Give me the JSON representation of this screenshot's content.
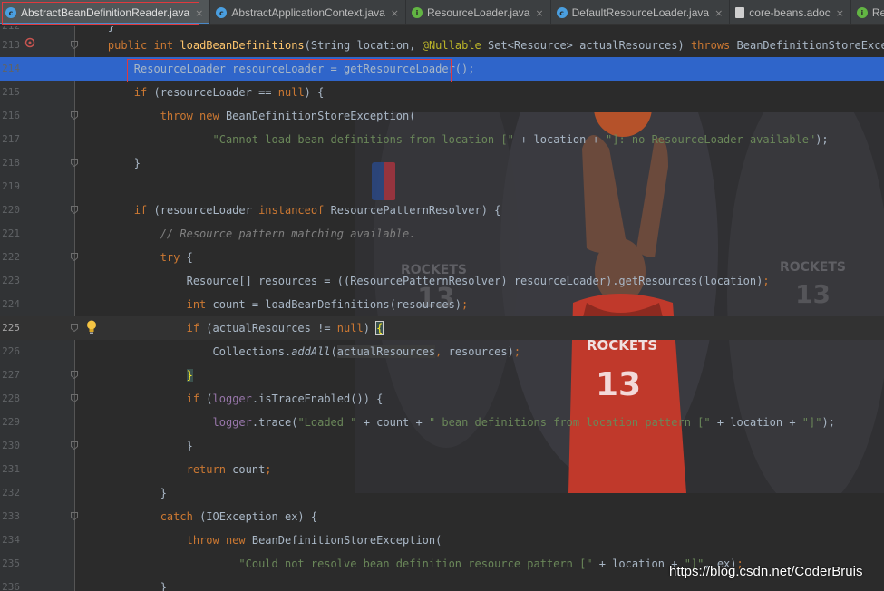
{
  "tabs": [
    {
      "label": "AbstractBeanDefinitionReader.java",
      "icon": "class-icon",
      "color": "#4a9fe0",
      "active": true,
      "closable": true
    },
    {
      "label": "AbstractApplicationContext.java",
      "icon": "class-icon",
      "color": "#4a9fe0",
      "active": false,
      "closable": true
    },
    {
      "label": "ResourceLoader.java",
      "icon": "interface-icon",
      "color": "#62b543",
      "active": false,
      "closable": true
    },
    {
      "label": "DefaultResourceLoader.java",
      "icon": "class-icon",
      "color": "#4a9fe0",
      "active": false,
      "closable": true
    },
    {
      "label": "core-beans.adoc",
      "icon": "file-icon",
      "color": "#cfcfcf",
      "active": false,
      "closable": true
    },
    {
      "label": "ResourcePatte",
      "icon": "interface-icon",
      "color": "#62b543",
      "active": false,
      "closable": false
    }
  ],
  "tab_glyphs": {
    "class": "c",
    "interface": "i",
    "close": "×"
  },
  "editor": {
    "current_line": "225",
    "selected_line": "214",
    "background_jersey": {
      "team": "ROCKETS",
      "number": "13"
    },
    "lines": [
      {
        "num": "212",
        "tokens": [
          {
            "t": "    }",
            "c": ""
          }
        ]
      },
      {
        "num": "213",
        "tokens": [
          {
            "t": "    ",
            "c": ""
          },
          {
            "t": "public int ",
            "c": "kw"
          },
          {
            "t": "loadBeanDefinitions",
            "c": "fn"
          },
          {
            "t": "(String location, ",
            "c": ""
          },
          {
            "t": "@Nullable",
            "c": "ann"
          },
          {
            "t": " Set<Resource> actualResources) ",
            "c": ""
          },
          {
            "t": "throws ",
            "c": "kw"
          },
          {
            "t": "BeanDefinitionStoreException {",
            "c": ""
          }
        ]
      },
      {
        "num": "214",
        "tokens": [
          {
            "t": "        ResourceLoader resourceLoader = getResourceLoader();",
            "c": ""
          }
        ]
      },
      {
        "num": "215",
        "tokens": [
          {
            "t": "        ",
            "c": ""
          },
          {
            "t": "if ",
            "c": "kw"
          },
          {
            "t": "(resourceLoader == ",
            "c": ""
          },
          {
            "t": "null",
            "c": "kw"
          },
          {
            "t": ") {",
            "c": ""
          }
        ]
      },
      {
        "num": "216",
        "tokens": [
          {
            "t": "            ",
            "c": ""
          },
          {
            "t": "throw new ",
            "c": "kw"
          },
          {
            "t": "BeanDefinitionStoreException(",
            "c": ""
          }
        ]
      },
      {
        "num": "217",
        "tokens": [
          {
            "t": "                    ",
            "c": ""
          },
          {
            "t": "\"Cannot load bean definitions from location [\"",
            "c": "str"
          },
          {
            "t": " + location + ",
            "c": ""
          },
          {
            "t": "\"]: no ResourceLoader available\"",
            "c": "str"
          },
          {
            "t": ");",
            "c": ""
          }
        ]
      },
      {
        "num": "218",
        "tokens": [
          {
            "t": "        }",
            "c": ""
          }
        ]
      },
      {
        "num": "219",
        "tokens": []
      },
      {
        "num": "220",
        "tokens": [
          {
            "t": "        ",
            "c": ""
          },
          {
            "t": "if ",
            "c": "kw"
          },
          {
            "t": "(resourceLoader ",
            "c": ""
          },
          {
            "t": "instanceof ",
            "c": "kw"
          },
          {
            "t": "ResourcePatternResolver) {",
            "c": ""
          }
        ]
      },
      {
        "num": "221",
        "tokens": [
          {
            "t": "            ",
            "c": ""
          },
          {
            "t": "// Resource pattern matching available.",
            "c": "cmt"
          }
        ]
      },
      {
        "num": "222",
        "tokens": [
          {
            "t": "            ",
            "c": ""
          },
          {
            "t": "try ",
            "c": "kw"
          },
          {
            "t": "{",
            "c": ""
          }
        ]
      },
      {
        "num": "223",
        "tokens": [
          {
            "t": "                Resource[] resources = ((ResourcePatternResolver) resourceLoader).getResources(location)",
            "c": ""
          },
          {
            "t": ";",
            "c": "kw"
          }
        ]
      },
      {
        "num": "224",
        "tokens": [
          {
            "t": "                ",
            "c": ""
          },
          {
            "t": "int ",
            "c": "kw"
          },
          {
            "t": "count = loadBeanDefinitions(resources)",
            "c": ""
          },
          {
            "t": ";",
            "c": "kw"
          }
        ]
      },
      {
        "num": "225",
        "tokens": [
          {
            "t": "                ",
            "c": ""
          },
          {
            "t": "if ",
            "c": "kw"
          },
          {
            "t": "(actualResources != ",
            "c": ""
          },
          {
            "t": "null",
            "c": "kw"
          },
          {
            "t": ") ",
            "c": ""
          },
          {
            "t": "{",
            "c": "brace-hl"
          }
        ]
      },
      {
        "num": "226",
        "tokens": [
          {
            "t": "                    Collections.",
            "c": ""
          },
          {
            "t": "addAll",
            "c": "ital"
          },
          {
            "t": "(",
            "c": ""
          },
          {
            "t": "actualResources",
            "c": "var-hl"
          },
          {
            "t": ", ",
            "c": "kw"
          },
          {
            "t": "resources)",
            "c": ""
          },
          {
            "t": ";",
            "c": "kw"
          }
        ]
      },
      {
        "num": "227",
        "tokens": [
          {
            "t": "                ",
            "c": ""
          },
          {
            "t": "}",
            "c": "brace-hl2"
          }
        ]
      },
      {
        "num": "228",
        "tokens": [
          {
            "t": "                ",
            "c": ""
          },
          {
            "t": "if ",
            "c": "kw"
          },
          {
            "t": "(",
            "c": ""
          },
          {
            "t": "logger",
            "c": "fld"
          },
          {
            "t": ".isTraceEnabled()) {",
            "c": ""
          }
        ]
      },
      {
        "num": "229",
        "tokens": [
          {
            "t": "                    ",
            "c": ""
          },
          {
            "t": "logger",
            "c": "fld"
          },
          {
            "t": ".trace(",
            "c": ""
          },
          {
            "t": "\"Loaded \"",
            "c": "str"
          },
          {
            "t": " + count + ",
            "c": ""
          },
          {
            "t": "\" bean definitions from location pattern [\"",
            "c": "str"
          },
          {
            "t": " + location + ",
            "c": ""
          },
          {
            "t": "\"]\"",
            "c": "str"
          },
          {
            "t": ");",
            "c": ""
          }
        ]
      },
      {
        "num": "230",
        "tokens": [
          {
            "t": "                }",
            "c": ""
          }
        ]
      },
      {
        "num": "231",
        "tokens": [
          {
            "t": "                ",
            "c": ""
          },
          {
            "t": "return ",
            "c": "kw"
          },
          {
            "t": "count",
            "c": ""
          },
          {
            "t": ";",
            "c": "kw"
          }
        ]
      },
      {
        "num": "232",
        "tokens": [
          {
            "t": "            }",
            "c": ""
          }
        ]
      },
      {
        "num": "233",
        "tokens": [
          {
            "t": "            ",
            "c": ""
          },
          {
            "t": "catch ",
            "c": "kw"
          },
          {
            "t": "(IOException ex) {",
            "c": ""
          }
        ]
      },
      {
        "num": "234",
        "tokens": [
          {
            "t": "                ",
            "c": ""
          },
          {
            "t": "throw new ",
            "c": "kw"
          },
          {
            "t": "BeanDefinitionStoreException(",
            "c": ""
          }
        ]
      },
      {
        "num": "235",
        "tokens": [
          {
            "t": "                        ",
            "c": ""
          },
          {
            "t": "\"Could not resolve bean definition resource pattern [\"",
            "c": "str"
          },
          {
            "t": " + location + ",
            "c": ""
          },
          {
            "t": "\"]\"",
            "c": "str"
          },
          {
            "t": ", ex)",
            "c": ""
          },
          {
            "t": ";",
            "c": "kw"
          }
        ]
      },
      {
        "num": "236",
        "tokens": [
          {
            "t": "            }",
            "c": ""
          }
        ]
      }
    ]
  },
  "watermark": "https://blog.csdn.net/CoderBruis",
  "colors": {
    "editor_bg": "#2b2b2b",
    "selection": "#2f65ca",
    "highlight_box": "#e0393e",
    "keyword": "#cc7832",
    "string": "#6a8759",
    "method": "#ffc66d",
    "annotation": "#bbb529",
    "field": "#9876aa"
  }
}
